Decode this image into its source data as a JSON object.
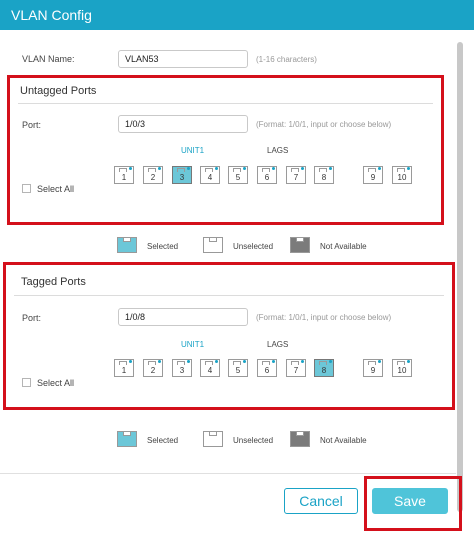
{
  "dialog": {
    "title": "VLAN Config"
  },
  "vlan_name": {
    "label": "VLAN Name:",
    "value": "VLAN53",
    "hint": "(1-16 characters)"
  },
  "untagged": {
    "title": "Untagged Ports",
    "port_label": "Port:",
    "port_value": "1/0/3",
    "port_hint": "(Format: 1/0/1, input or choose below)",
    "unit_label": "UNIT1",
    "lags_label": "LAGS",
    "select_all": "Select All",
    "ports": [
      {
        "num": "1",
        "state": "unselected"
      },
      {
        "num": "2",
        "state": "unselected"
      },
      {
        "num": "3",
        "state": "selected"
      },
      {
        "num": "4",
        "state": "unselected"
      },
      {
        "num": "5",
        "state": "unselected"
      },
      {
        "num": "6",
        "state": "unselected"
      },
      {
        "num": "7",
        "state": "unselected"
      },
      {
        "num": "8",
        "state": "unselected"
      }
    ],
    "lags": [
      {
        "num": "9",
        "state": "unselected"
      },
      {
        "num": "10",
        "state": "unselected"
      }
    ]
  },
  "tagged": {
    "title": "Tagged Ports",
    "port_label": "Port:",
    "port_value": "1/0/8",
    "port_hint": "(Format: 1/0/1, input or choose below)",
    "unit_label": "UNIT1",
    "lags_label": "LAGS",
    "select_all": "Select All",
    "ports": [
      {
        "num": "1",
        "state": "unselected"
      },
      {
        "num": "2",
        "state": "unselected"
      },
      {
        "num": "3",
        "state": "unselected"
      },
      {
        "num": "4",
        "state": "unselected"
      },
      {
        "num": "5",
        "state": "unselected"
      },
      {
        "num": "6",
        "state": "unselected"
      },
      {
        "num": "7",
        "state": "unselected"
      },
      {
        "num": "8",
        "state": "selected"
      }
    ],
    "lags": [
      {
        "num": "9",
        "state": "unselected"
      },
      {
        "num": "10",
        "state": "unselected"
      }
    ]
  },
  "legend": {
    "selected": "Selected",
    "unselected": "Unselected",
    "not_available": "Not Available"
  },
  "buttons": {
    "cancel": "Cancel",
    "save": "Save"
  },
  "colors": {
    "accent": "#1aa3c6",
    "selected_port": "#6cc7d8",
    "not_available": "#7b7b7b",
    "highlight": "#d4101b"
  }
}
